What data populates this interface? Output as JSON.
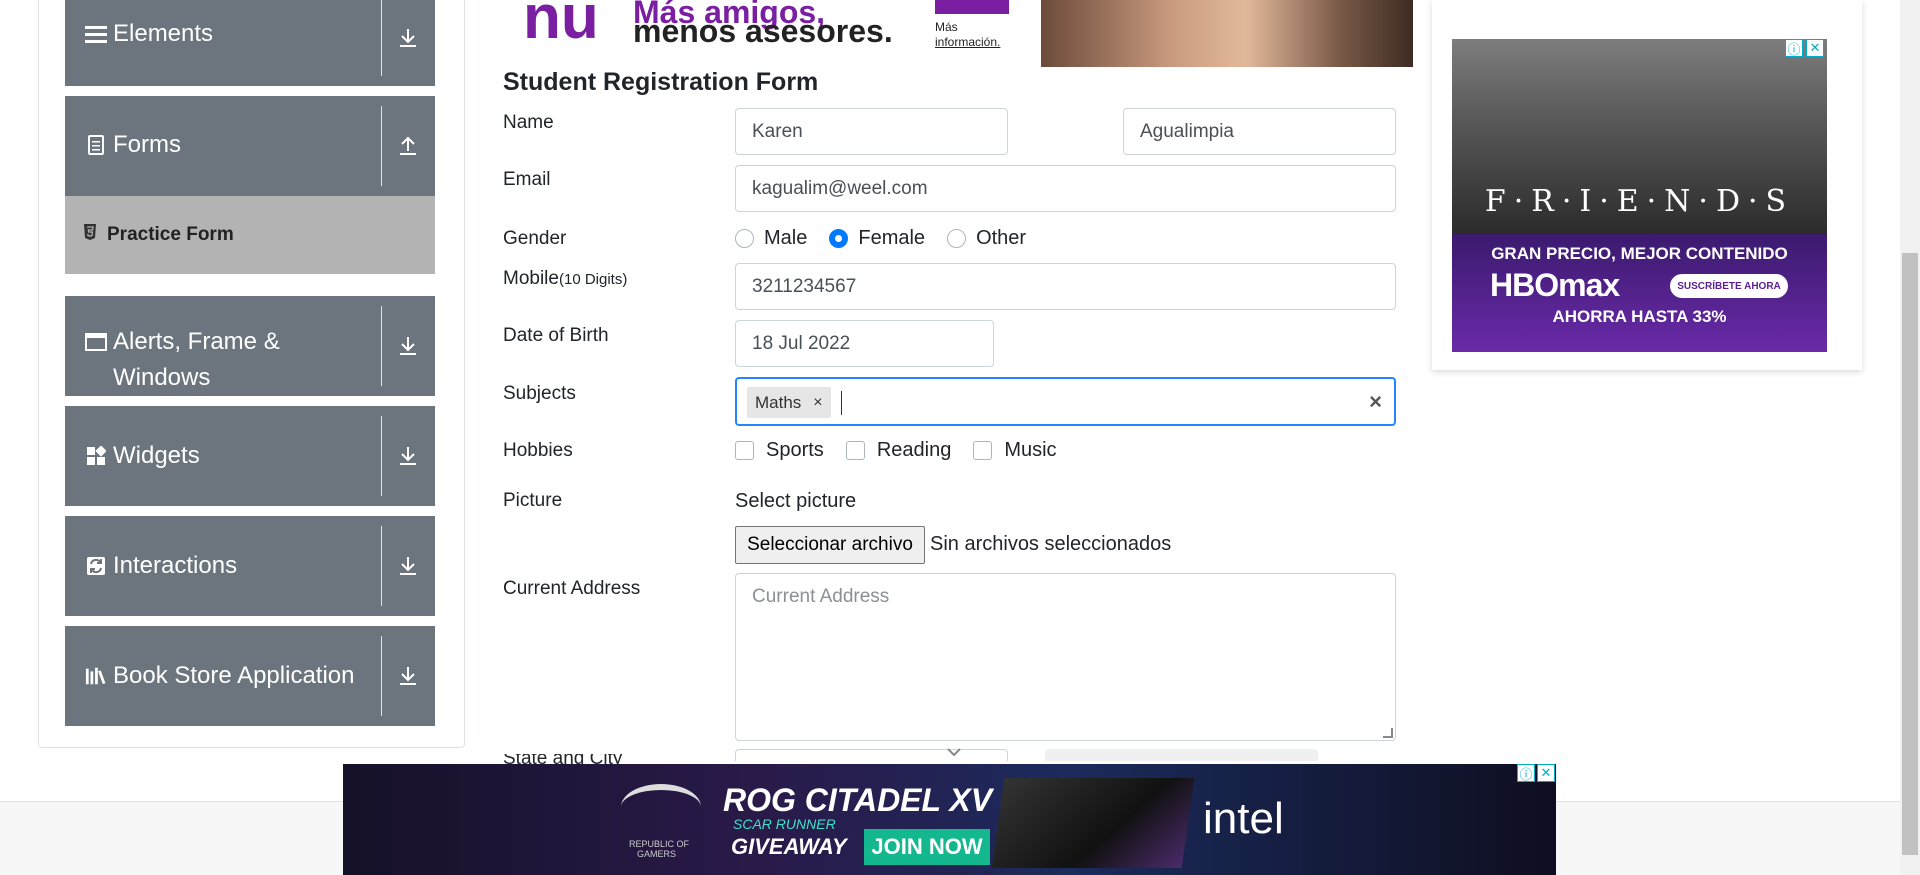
{
  "sidebar": {
    "groups": [
      {
        "label": "Elements",
        "icon": "menu-icon",
        "arrow": "download"
      },
      {
        "label": "Forms",
        "icon": "document-icon",
        "arrow": "upload"
      },
      {
        "label": "Alerts, Frame &",
        "label2": "Windows",
        "icon": "window-icon",
        "arrow": "download"
      },
      {
        "label": "Widgets",
        "icon": "widgets-icon",
        "arrow": "download"
      },
      {
        "label": "Interactions",
        "icon": "interactions-icon",
        "arrow": "download"
      },
      {
        "label": "Book Store Application",
        "icon": "books-icon",
        "arrow": "download"
      }
    ],
    "active_item": "Practice Form"
  },
  "top_ad": {
    "logo": "nu",
    "line1": "Más amigos,",
    "line2": "menos asesores.",
    "more1": "Más",
    "more2": "información."
  },
  "form": {
    "title": "Student Registration Form",
    "name_label": "Name",
    "first_name": "Karen",
    "last_name": "Agualimpia",
    "email_label": "Email",
    "email": "kagualim@weel.com",
    "gender_label": "Gender",
    "gender_options": [
      "Male",
      "Female",
      "Other"
    ],
    "gender_selected": "Female",
    "mobile_label": "Mobile",
    "mobile_hint": "(10 Digits)",
    "mobile": "3211234567",
    "dob_label": "Date of Birth",
    "dob": "18 Jul 2022",
    "subjects_label": "Subjects",
    "subjects": [
      "Maths"
    ],
    "subject_remove": "×",
    "subjects_clear": "×",
    "hobbies_label": "Hobbies",
    "hobbies": [
      "Sports",
      "Reading",
      "Music"
    ],
    "picture_label": "Picture",
    "select_picture": "Select picture",
    "file_button": "Seleccionar archivo",
    "file_status": "Sin archivos seleccionados",
    "address_label": "Current Address",
    "address_placeholder": "Current Address",
    "state_city_label": "State and City"
  },
  "right_ad": {
    "title": "F·R·I·E·N·D·S",
    "line1": "GRAN PRECIO, MEJOR CONTENIDO",
    "brand": "HBOmax",
    "cta": "SUSCRÍBETE AHORA",
    "line3": "AHORRA HASTA 33%"
  },
  "bottom_ad": {
    "product": "ROG CITADEL XV",
    "edition": "SCAR RUNNER",
    "giveaway": "GIVEAWAY",
    "cta": "JOIN NOW",
    "partner": "intel",
    "rog_line1": "REPUBLIC OF",
    "rog_line2": "GAMERS"
  },
  "ad_controls": {
    "info": "ⓘ",
    "close": "✕"
  },
  "colors": {
    "sidebar": "#6c757d",
    "active_item": "#b3b3b3",
    "accent": "#007bff",
    "focus_border": "#2684ff"
  }
}
